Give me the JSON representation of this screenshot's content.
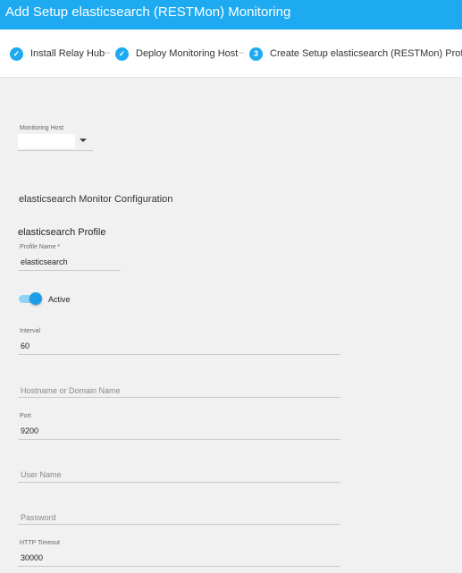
{
  "header": {
    "title": "Add Setup elasticsearch (RESTMon) Monitoring"
  },
  "steps": [
    {
      "number": "✓",
      "label": "Install Relay Hub"
    },
    {
      "number": "✓",
      "label": "Deploy Monitoring Host"
    },
    {
      "number": "3",
      "label": "Create Setup elasticsearch (RESTMon) Profile"
    }
  ],
  "step_separator": "–",
  "monitoring_host": {
    "label": "Monitoring Host",
    "value": ""
  },
  "config_title": "elasticsearch Monitor Configuration",
  "profile_title": "elasticsearch Profile",
  "profile_name": {
    "label": "Profile Name *",
    "value": "elasticsearch"
  },
  "active_toggle": {
    "label": "Active",
    "on": true
  },
  "interval": {
    "label": "Interval",
    "value": "60"
  },
  "hostname": {
    "placeholder": "Hostname or Domain Name"
  },
  "port": {
    "label": "Port",
    "value": "9200"
  },
  "username": {
    "placeholder": "User Name"
  },
  "password": {
    "placeholder": "Password"
  },
  "http_timeout": {
    "label": "HTTP Timeout",
    "value": "30000"
  },
  "colors": {
    "accent": "#1eaaf1",
    "background": "#f1f1f1"
  }
}
